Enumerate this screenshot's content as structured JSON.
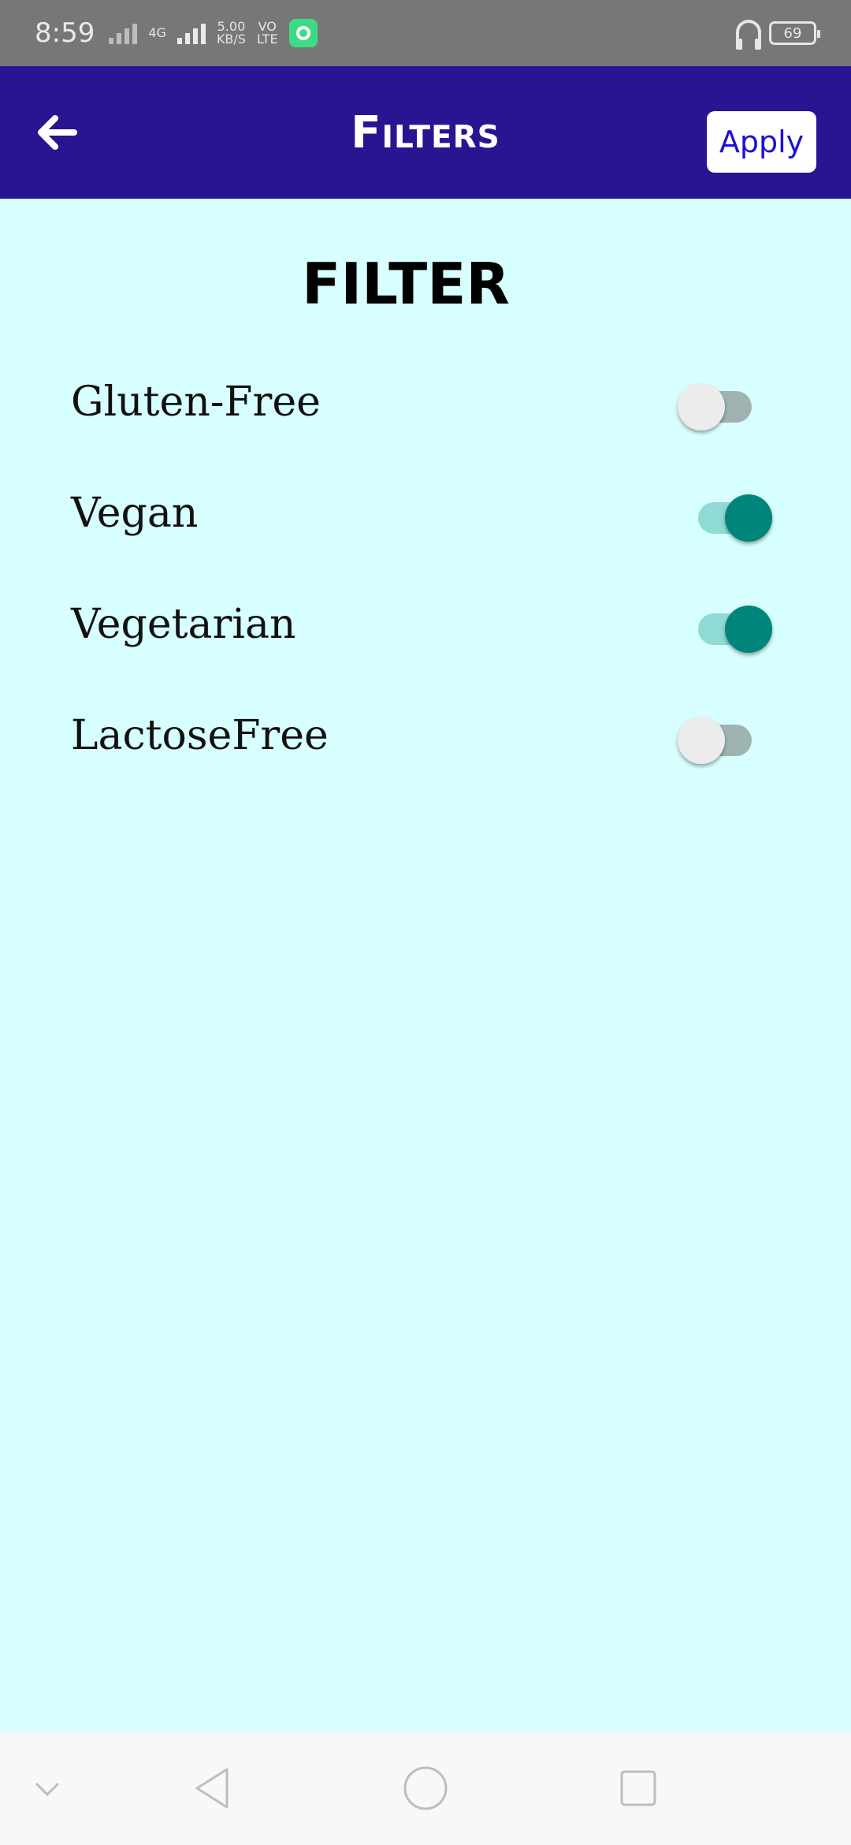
{
  "status_bar": {
    "time": "8:59",
    "network_gen": "4G",
    "speed_value": "5.00",
    "speed_unit": "KB/S",
    "volte_top": "VO",
    "volte_bottom": "LTE",
    "battery": "69"
  },
  "app_bar": {
    "title": "Filters",
    "apply_label": "Apply",
    "background": "#271592"
  },
  "main": {
    "heading": "FILTER",
    "filters": [
      {
        "label": "Gluten-Free",
        "enabled": false
      },
      {
        "label": "Vegan",
        "enabled": true
      },
      {
        "label": "Vegetarian",
        "enabled": true
      },
      {
        "label": "LactoseFree",
        "enabled": false
      }
    ]
  },
  "colors": {
    "page_background": "#d8ffff",
    "switch_on": "#00857a",
    "apply_text": "#1a12d6"
  }
}
